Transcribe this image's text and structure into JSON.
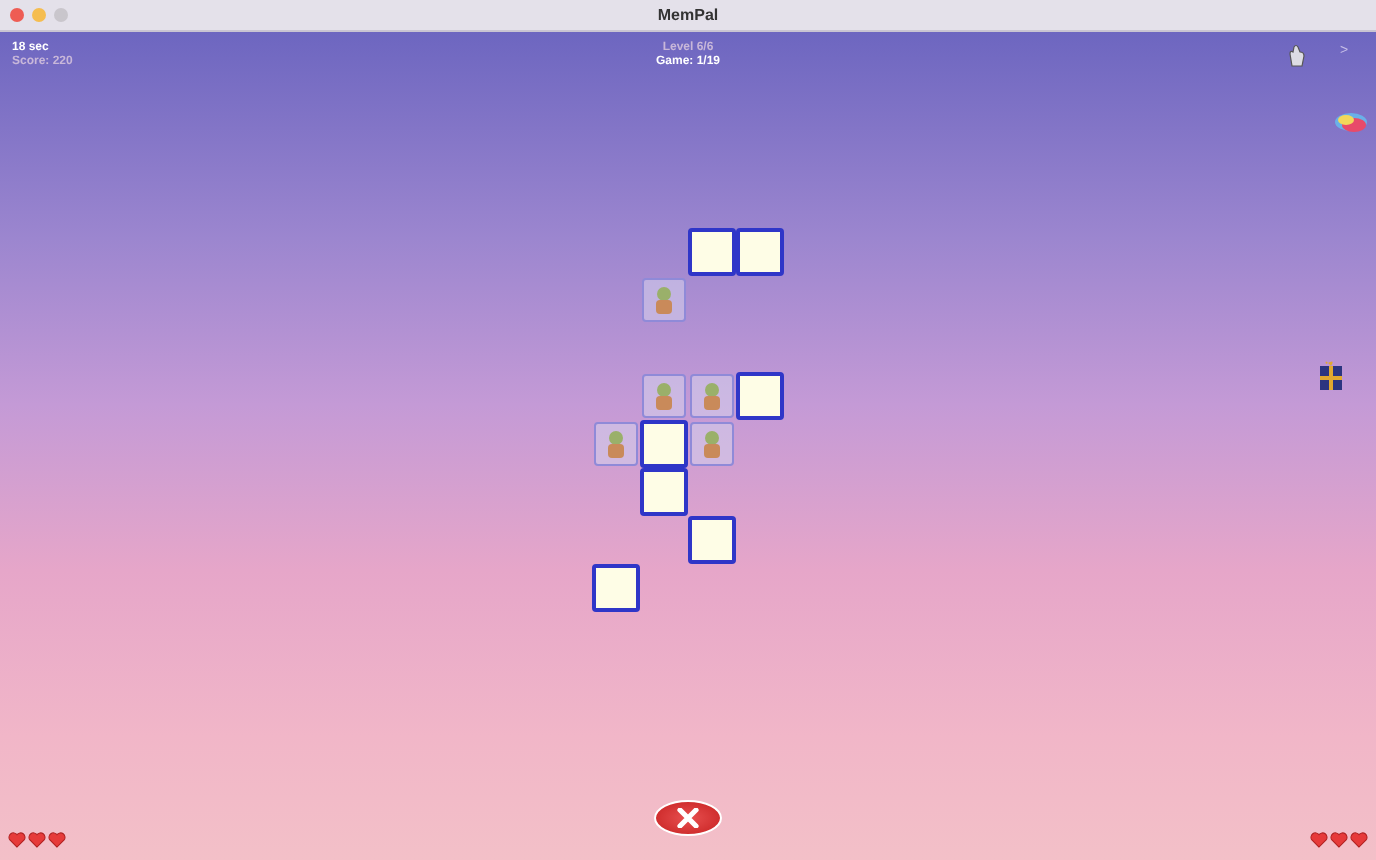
{
  "window": {
    "title": "MemPal"
  },
  "status": {
    "time": "18 sec",
    "score": "Score: 220",
    "level": "Level 6/6",
    "game": "Game: 1/19"
  },
  "next_label": ">",
  "board": [
    [
      {
        "kind": "empty"
      },
      {
        "kind": "empty"
      },
      {
        "kind": "hidden"
      },
      {
        "kind": "hidden"
      }
    ],
    [
      {
        "kind": "empty"
      },
      {
        "kind": "matched"
      },
      {
        "kind": "empty"
      },
      {
        "kind": "empty"
      }
    ],
    [
      {
        "kind": "empty"
      },
      {
        "kind": "empty"
      },
      {
        "kind": "empty"
      },
      {
        "kind": "empty"
      }
    ],
    [
      {
        "kind": "empty"
      },
      {
        "kind": "matched"
      },
      {
        "kind": "matched"
      },
      {
        "kind": "hidden"
      }
    ],
    [
      {
        "kind": "matched"
      },
      {
        "kind": "hidden"
      },
      {
        "kind": "matched"
      },
      {
        "kind": "empty"
      }
    ],
    [
      {
        "kind": "empty"
      },
      {
        "kind": "hidden"
      },
      {
        "kind": "empty"
      },
      {
        "kind": "empty"
      }
    ],
    [
      {
        "kind": "empty"
      },
      {
        "kind": "empty"
      },
      {
        "kind": "hidden"
      },
      {
        "kind": "empty"
      }
    ],
    [
      {
        "kind": "hidden"
      },
      {
        "kind": "empty"
      },
      {
        "kind": "empty"
      },
      {
        "kind": "empty"
      }
    ]
  ],
  "lives_left": [
    {
      "filled": true
    },
    {
      "filled": true
    },
    {
      "filled": true
    }
  ],
  "lives_right": [
    {
      "filled": true
    },
    {
      "filled": true
    },
    {
      "filled": true
    }
  ]
}
